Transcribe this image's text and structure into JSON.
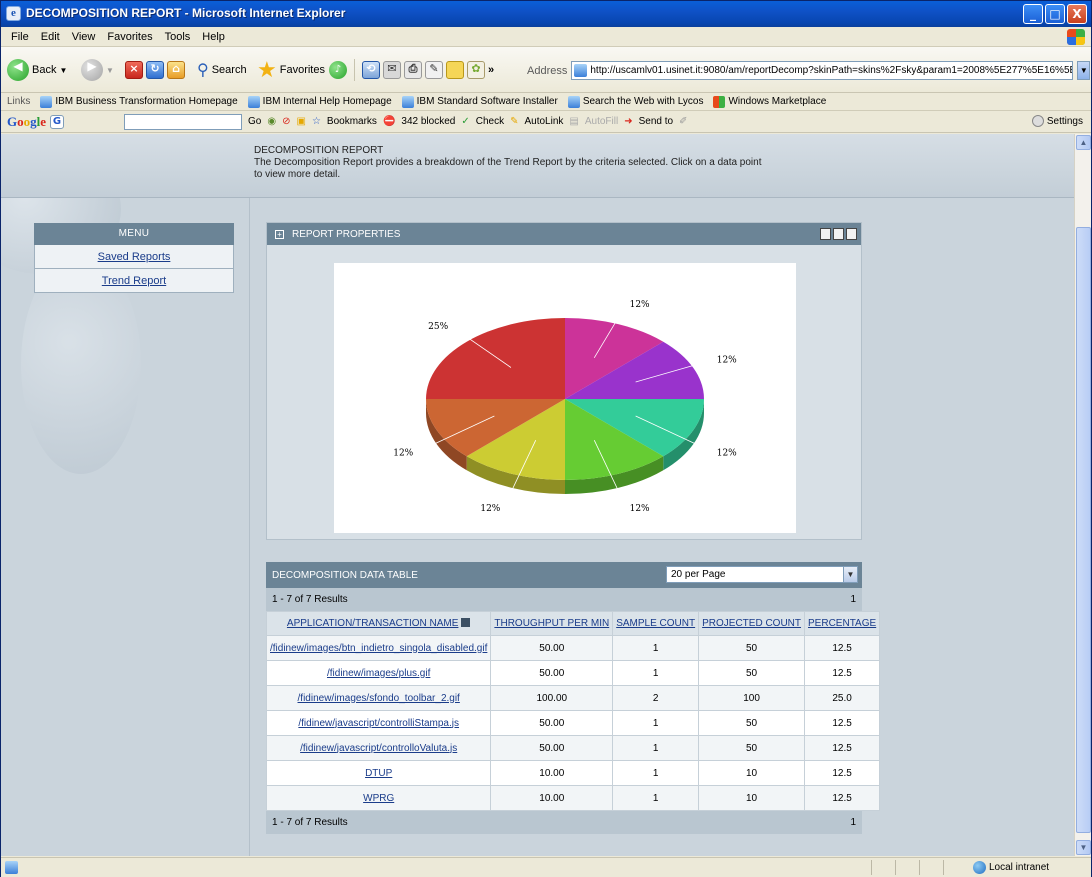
{
  "window": {
    "title": "DECOMPOSITION REPORT - Microsoft Internet Explorer",
    "buttons": [
      "_",
      "□",
      "X"
    ]
  },
  "menubar": [
    "File",
    "Edit",
    "View",
    "Favorites",
    "Tools",
    "Help"
  ],
  "toolbar": {
    "back": "Back",
    "search": "Search",
    "favorites": "Favorites",
    "address_label": "Address",
    "address_value": "http://uscamlv01.usinet.it:9080/am/reportDecomp?skinPath=skins%2Fsky&param1=2008%5E277%5E16%5E16&displa",
    "go": "Go",
    "chevron": "»"
  },
  "links": {
    "label": "Links",
    "items": [
      "IBM Business Transformation Homepage",
      "IBM Internal Help Homepage",
      "IBM Standard Software Installer",
      "Search the Web with Lycos",
      "Windows Marketplace"
    ]
  },
  "googlebar": {
    "go": "Go",
    "bookmarks": "Bookmarks",
    "blocked": "342 blocked",
    "check": "Check",
    "autolink": "AutoLink",
    "autofill": "AutoFill",
    "sendto": "Send to",
    "settings": "Settings"
  },
  "page": {
    "header_title": "DECOMPOSITION REPORT",
    "header_desc_1": "The Decomposition Report provides a breakdown of the Trend Report by the criteria selected. Click on a data point",
    "header_desc_2": "to view more detail.",
    "menu": {
      "title": "MENU",
      "items": [
        "Saved Reports",
        "Trend Report"
      ]
    },
    "report_properties": "REPORT PROPERTIES",
    "table": {
      "title": "DECOMPOSITION DATA TABLE",
      "per_page": "20 per Page",
      "results": "1 - 7 of 7 Results",
      "page_no": "1",
      "headers": [
        "APPLICATION/TRANSACTION NAME",
        "THROUGHPUT PER MIN",
        "SAMPLE COUNT",
        "PROJECTED COUNT",
        "PERCENTAGE"
      ],
      "rows": [
        [
          "/fidinew/images/btn_indietro_singola_disabled.gif",
          "50.00",
          "1",
          "50",
          "12.5"
        ],
        [
          "/fidinew/images/plus.gif",
          "50.00",
          "1",
          "50",
          "12.5"
        ],
        [
          "/fidinew/images/sfondo_toolbar_2.gif",
          "100.00",
          "2",
          "100",
          "25.0"
        ],
        [
          "/fidinew/javascript/controlliStampa.js",
          "50.00",
          "1",
          "50",
          "12.5"
        ],
        [
          "/fidinew/javascript/controlloValuta.js",
          "50.00",
          "1",
          "50",
          "12.5"
        ],
        [
          "DTUP",
          "10.00",
          "1",
          "10",
          "12.5"
        ],
        [
          "WPRG",
          "10.00",
          "1",
          "10",
          "12.5"
        ]
      ]
    }
  },
  "chart_data": {
    "type": "pie",
    "slices": [
      {
        "label": "12%",
        "value": 12.5,
        "color": "#cc3399"
      },
      {
        "label": "12%",
        "value": 12.5,
        "color": "#9933cc"
      },
      {
        "label": "12%",
        "value": 12.5,
        "color": "#33cc99"
      },
      {
        "label": "12%",
        "value": 12.5,
        "color": "#66cc33"
      },
      {
        "label": "12%",
        "value": 12.5,
        "color": "#cccc33"
      },
      {
        "label": "12%",
        "value": 12.5,
        "color": "#cc6633"
      },
      {
        "label": "25%",
        "value": 25.0,
        "color": "#cc3333"
      }
    ]
  },
  "statusbar": {
    "zone": "Local intranet"
  }
}
